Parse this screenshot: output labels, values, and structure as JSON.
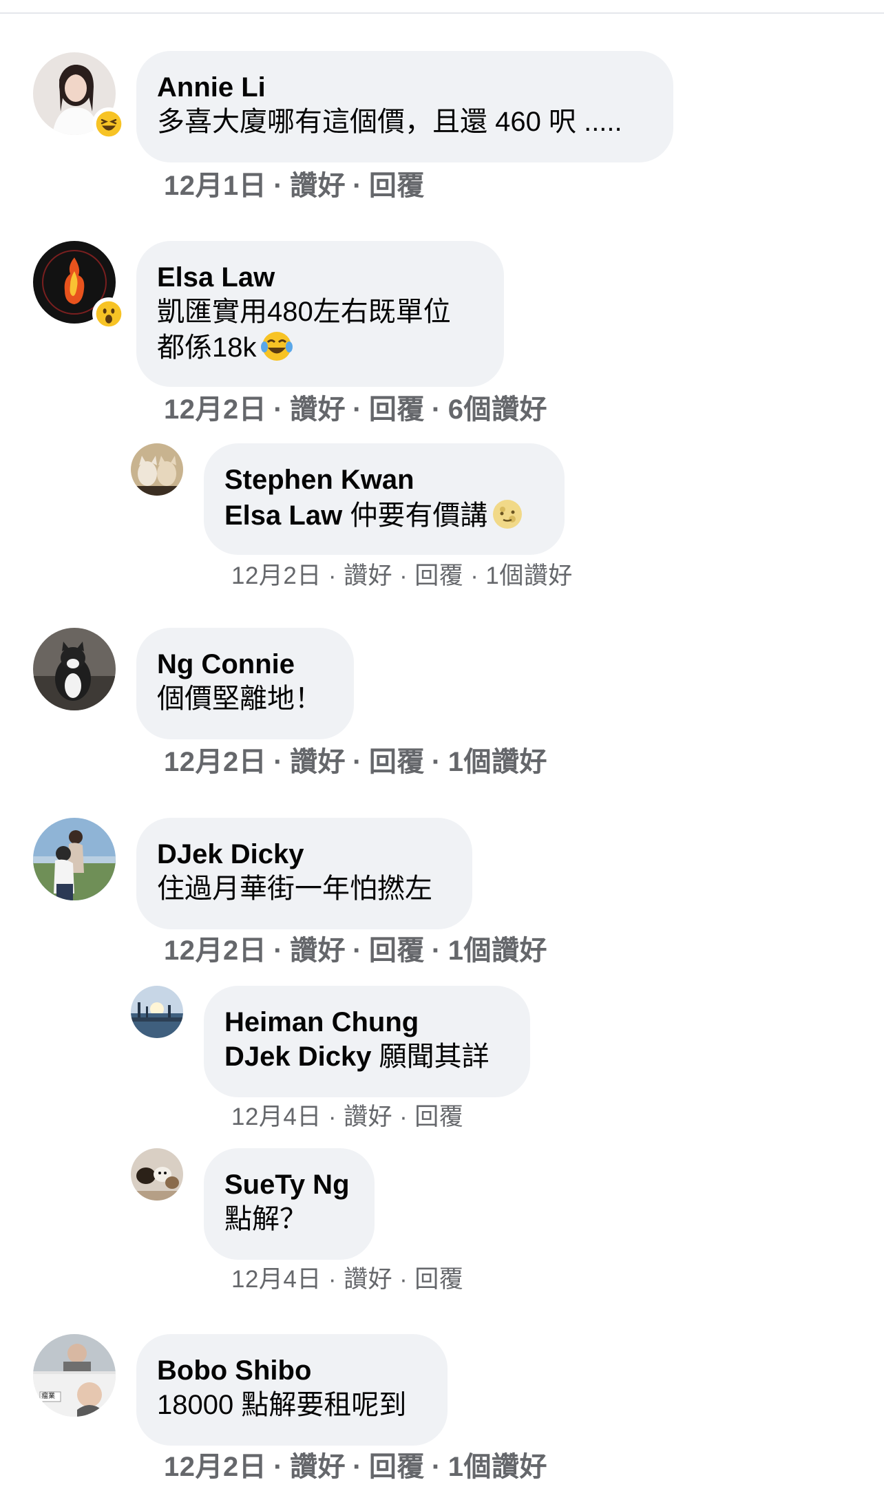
{
  "separator": "·",
  "like_label": "讚好",
  "reply_label": "回覆",
  "comments": [
    {
      "name": "Annie Li",
      "text": "多喜大廈哪有這個價，且還 460 呎 .....",
      "date": "12月1日",
      "likes": "",
      "reaction": "laughing-squint-emoji",
      "avatar": "woman-portrait"
    },
    {
      "name": "Elsa Law",
      "text_line1": "凱匯實用480左右既單位",
      "text_line2": "都係18k",
      "date": "12月2日",
      "likes": "6個讚好",
      "reaction": "wow-emoji",
      "inline_emoji": "tears-of-joy-emoji",
      "avatar": "fire-hand-logo"
    },
    {
      "name": "Stephen Kwan",
      "mention": "Elsa Law",
      "text": "仲要有價講",
      "date": "12月2日",
      "likes": "1個讚好",
      "inline_emoji": "moon-face-emoji",
      "avatar": "two-cats"
    },
    {
      "name": "Ng Connie",
      "text": "個價堅離地！",
      "date": "12月2日",
      "likes": "1個讚好",
      "avatar": "cat-on-sofa"
    },
    {
      "name": "DJek Dicky",
      "text": "住過月華街一年怕撚左",
      "date": "12月2日",
      "likes": "1個讚好",
      "avatar": "couple-outdoors"
    },
    {
      "name": "Heiman Chung",
      "mention": "DJek Dicky",
      "text": "願聞其詳",
      "date": "12月4日",
      "likes": "",
      "avatar": "harbour-sunset"
    },
    {
      "name": "SueTy Ng",
      "text": "點解？",
      "date": "12月4日",
      "likes": "",
      "avatar": "pets-photo"
    },
    {
      "name": "Bobo Shibo",
      "text": "18000 點解要租呢到",
      "date": "12月2日",
      "likes": "1個讚好",
      "avatar": "meme-collage",
      "avatar_caption": "瘤業"
    }
  ]
}
